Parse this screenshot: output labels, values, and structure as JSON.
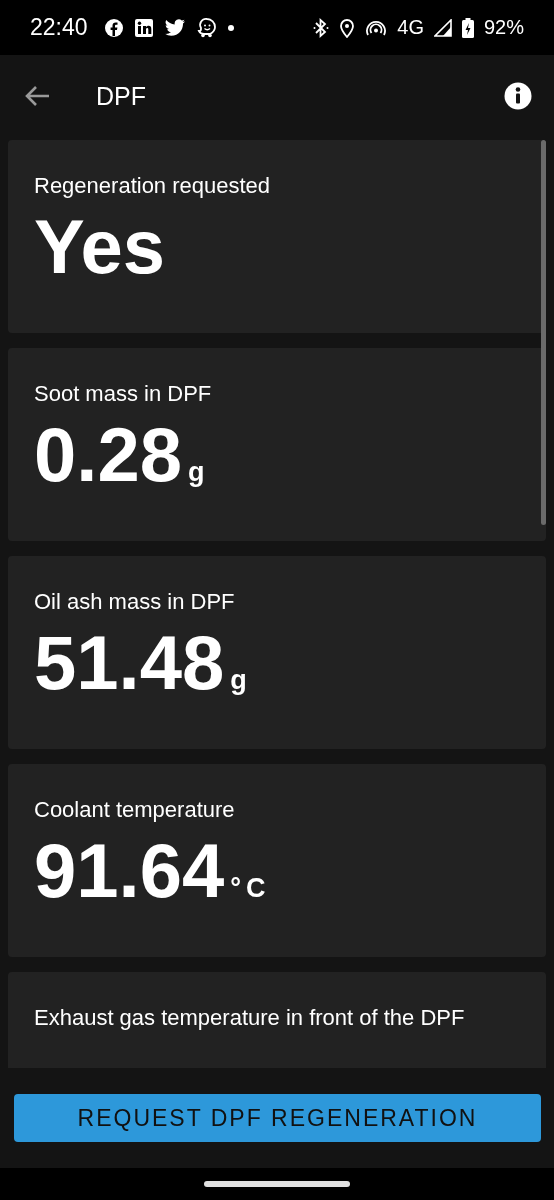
{
  "status_bar": {
    "time": "22:40",
    "network": "4G",
    "battery": "92%"
  },
  "toolbar": {
    "title": "DPF"
  },
  "cards": [
    {
      "label": "Regeneration requested",
      "value": "Yes"
    },
    {
      "label": "Soot mass in DPF",
      "value": "0.28",
      "unit": "g"
    },
    {
      "label": "Oil ash mass in DPF",
      "value": "51.48",
      "unit": "g"
    },
    {
      "label": "Coolant temperature",
      "value": "91.64",
      "unit": "°C"
    },
    {
      "label": "Exhaust gas temperature in front of the DPF"
    }
  ],
  "action_button": {
    "label": "REQUEST DPF REGENERATION"
  }
}
